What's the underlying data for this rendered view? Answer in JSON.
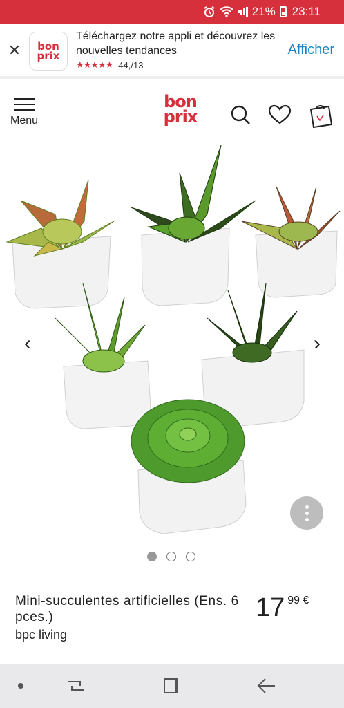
{
  "status_bar": {
    "battery_percent": "21%",
    "time": "23:11"
  },
  "app_banner": {
    "app_logo_line1": "bon",
    "app_logo_line2": "prix",
    "text": "Téléchargez notre appli et découvrez les nouvelles tendances",
    "stars": "★★★★★",
    "rating": "44,/13",
    "action_label": "Afficher"
  },
  "header": {
    "menu_label": "Menu",
    "logo_line1": "bon",
    "logo_line2": "prix"
  },
  "gallery": {
    "slide_count": 3,
    "active_slide": 1
  },
  "product": {
    "title": "Mini-succulentes artificielles (Ens. 6 pces.)",
    "brand": "bpc living",
    "price_main": "17",
    "price_cents": "99 €"
  },
  "colors": {
    "brand_red": "#d6303d",
    "link_blue": "#1a86c7"
  },
  "icons": [
    "alarm-icon",
    "wifi-icon",
    "signal-icon",
    "battery-icon",
    "close-icon",
    "menu-icon",
    "search-icon",
    "heart-icon",
    "bag-icon",
    "chevron-left-icon",
    "chevron-right-icon",
    "more-vertical-icon",
    "home-dot-icon",
    "recent-apps-icon",
    "overview-icon",
    "back-icon"
  ]
}
